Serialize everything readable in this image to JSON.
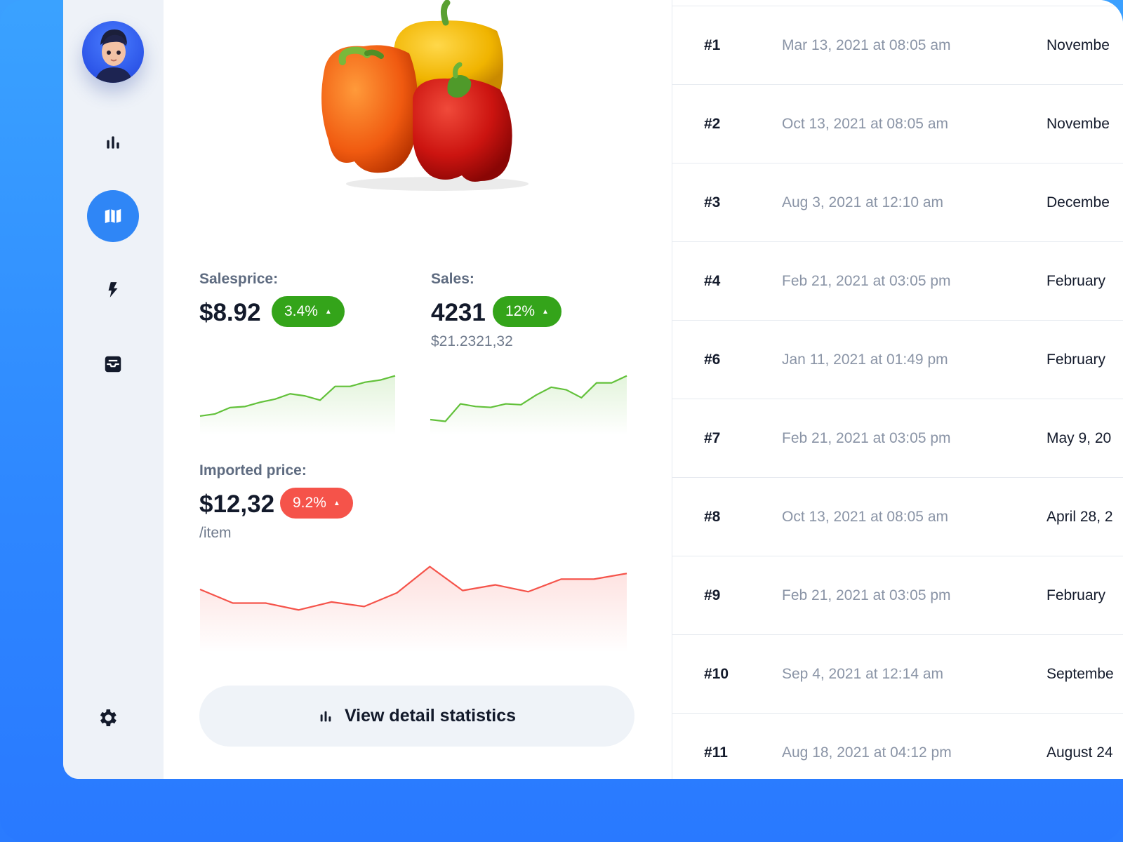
{
  "colors": {
    "accent": "#2f86f6",
    "positive": "#34a41a",
    "negative": "#f5534a",
    "sidebar_bg": "#eef2f8",
    "text_dark": "#131a2b",
    "text_muted": "#8a94a6"
  },
  "sidebar": {
    "avatar": "user-avatar",
    "items": [
      {
        "icon": "bar-chart-icon",
        "active": false
      },
      {
        "icon": "map-icon",
        "active": true
      },
      {
        "icon": "lightning-icon",
        "active": false
      },
      {
        "icon": "inbox-icon",
        "active": false
      }
    ],
    "settings_icon": "gear-icon"
  },
  "product": {
    "image": "bell-peppers-image"
  },
  "metrics": {
    "salesprice": {
      "label": "Salesprice:",
      "value": "$8.92",
      "change": "3.4%",
      "trend": [
        10,
        12,
        18,
        19,
        23,
        26,
        31,
        29,
        25,
        38,
        38,
        42,
        44,
        48
      ]
    },
    "sales": {
      "label": "Sales:",
      "value": "4231",
      "change": "12%",
      "sub": "$21.2321,32",
      "trend": [
        8,
        6,
        26,
        23,
        22,
        26,
        25,
        36,
        45,
        42,
        33,
        50,
        50,
        58
      ]
    },
    "imported_price": {
      "label": "Imported price:",
      "value": "$12,32",
      "change": "9.2%",
      "sub": "/item",
      "trend": [
        48,
        36,
        36,
        30,
        37,
        33,
        45,
        68,
        47,
        52,
        46,
        57,
        57,
        62
      ]
    }
  },
  "actions": {
    "view_stats_label": "View detail statistics",
    "view_stats_icon": "bar-chart-icon"
  },
  "orders": [
    {
      "id": "#1",
      "date": "Mar 13, 2021 at 08:05 am",
      "due": "Novembe"
    },
    {
      "id": "#2",
      "date": "Oct 13, 2021 at 08:05 am",
      "due": "Novembe"
    },
    {
      "id": "#3",
      "date": "Aug 3, 2021 at 12:10 am",
      "due": "Decembe"
    },
    {
      "id": "#4",
      "date": "Feb 21, 2021 at 03:05 pm",
      "due": "February"
    },
    {
      "id": "#6",
      "date": "Jan 11, 2021 at 01:49 pm",
      "due": "February"
    },
    {
      "id": "#7",
      "date": "Feb 21, 2021 at 03:05 pm",
      "due": "May 9, 20"
    },
    {
      "id": "#8",
      "date": "Oct 13, 2021 at 08:05 am",
      "due": "April 28, 2"
    },
    {
      "id": "#9",
      "date": "Feb 21, 2021 at 03:05 pm",
      "due": "February"
    },
    {
      "id": "#10",
      "date": "Sep 4, 2021 at 12:14 am",
      "due": "Septembe"
    },
    {
      "id": "#11",
      "date": "Aug 18, 2021 at 04:12 pm",
      "due": "August 24"
    }
  ]
}
